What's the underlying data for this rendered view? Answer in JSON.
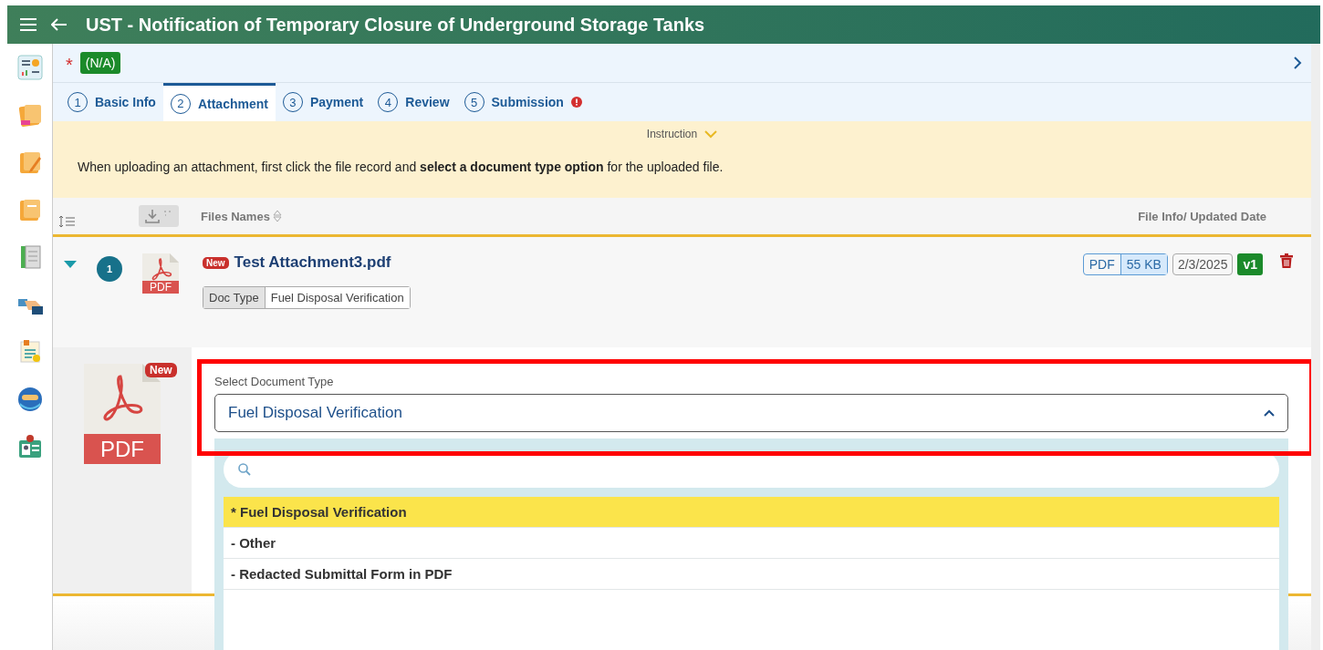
{
  "header": {
    "title": "UST - Notification of Temporary Closure of Underground Storage Tanks"
  },
  "status": {
    "required_mark": "*",
    "badge": "(N/A)"
  },
  "steps": [
    {
      "number": "1",
      "label": "Basic Info",
      "selected": false,
      "alert": false
    },
    {
      "number": "2",
      "label": "Attachment",
      "selected": true,
      "alert": false
    },
    {
      "number": "3",
      "label": "Payment",
      "selected": false,
      "alert": false
    },
    {
      "number": "4",
      "label": "Review",
      "selected": false,
      "alert": false
    },
    {
      "number": "5",
      "label": "Submission",
      "selected": false,
      "alert": true
    }
  ],
  "instruction": {
    "toggle": "Instruction",
    "expanded": true,
    "text": "When uploading an attachment, first click the file record and **select a document type option** for the uploaded file."
  },
  "table": {
    "columns": [
      "Files Names",
      "File Info/ Updated Date"
    ],
    "rows": [
      {
        "index": "1",
        "expanded": true,
        "badge": "New",
        "file_icon_label": "PDF",
        "name": "Test Attachment3.pdf",
        "doc_type_label": "Doc Type",
        "doc_type": "Fuel Disposal Verification",
        "format": "PDF",
        "size": "55 KB",
        "date": "2/3/2025",
        "version": "v1"
      }
    ]
  },
  "detail": {
    "badge": "New",
    "file_label": "PDF",
    "select": {
      "label": "Select Document Type",
      "value": "Fuel Disposal Verification",
      "expanded": true
    },
    "options": [
      {
        "label": "* Fuel Disposal Verification",
        "selected": true
      },
      {
        "label": "- Other",
        "selected": false
      },
      {
        "label": "- Redacted Submittal Form in PDF",
        "selected": false
      }
    ]
  }
}
